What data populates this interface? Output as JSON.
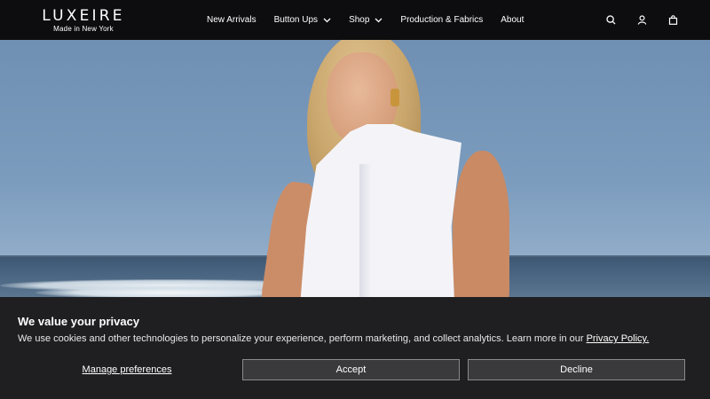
{
  "brand": {
    "logo": "LUXEIRE",
    "tagline": "Made in New York"
  },
  "nav": {
    "items": [
      {
        "label": "New Arrivals",
        "dropdown": false
      },
      {
        "label": "Button Ups",
        "dropdown": true
      },
      {
        "label": "Shop",
        "dropdown": true
      },
      {
        "label": "Production & Fabrics",
        "dropdown": false
      },
      {
        "label": "About",
        "dropdown": false
      }
    ]
  },
  "header_icons": [
    "search-icon",
    "account-icon",
    "bag-icon"
  ],
  "cookie_banner": {
    "title": "We value your privacy",
    "text": "We use cookies and other technologies to personalize your experience, perform marketing, and collect analytics. Learn more in our ",
    "link": "Privacy Policy.",
    "manage_label": "Manage preferences",
    "accept_label": "Accept",
    "decline_label": "Decline"
  },
  "colors": {
    "header_bg": "#0d0d0f",
    "banner_bg": "#1f1f21",
    "button_bg": "#3a3a3d",
    "button_border": "#8a8a8e"
  }
}
